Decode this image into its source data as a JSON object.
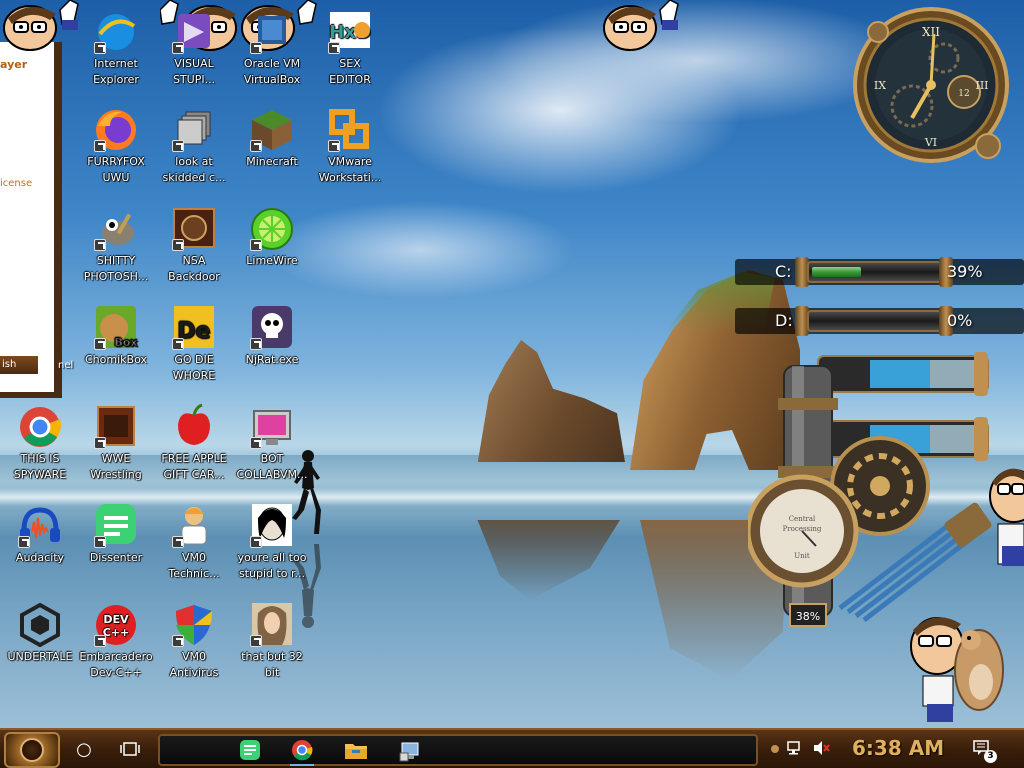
{
  "desktop": {
    "icons": [
      {
        "id": "ie",
        "label": "Internet\nExplorer"
      },
      {
        "id": "vs",
        "label": "VISUAL\nSTUPI..."
      },
      {
        "id": "vbox",
        "label": "Oracle VM\nVirtualBox"
      },
      {
        "id": "hxd",
        "label": "SEX\nEDITOR"
      },
      {
        "id": "firefox",
        "label": "FURRYFOX\nUWU"
      },
      {
        "id": "skidded",
        "label": "look at\nskidded c..."
      },
      {
        "id": "minecraft",
        "label": "Minecraft"
      },
      {
        "id": "vmware",
        "label": "VMware\nWorkstati..."
      },
      {
        "id": "gimp",
        "label": "SHITTY\nPHOTOSH..."
      },
      {
        "id": "nsa",
        "label": "NSA\nBackdoor"
      },
      {
        "id": "limewire",
        "label": "LimeWire"
      },
      {
        "id": "chomik",
        "label": "ChomikBox"
      },
      {
        "id": "godie",
        "label": "GO DIE\nWHORE"
      },
      {
        "id": "njrat",
        "label": "NjRat.exe"
      },
      {
        "id": "chrome",
        "label": "THIS IS\nSPYWARE"
      },
      {
        "id": "wwe",
        "label": "WWE\nWrestling"
      },
      {
        "id": "apple",
        "label": "FREE APPLE\nGIFT CAR..."
      },
      {
        "id": "bot",
        "label": "BOT\nCOLLABVM..."
      },
      {
        "id": "audacity",
        "label": "Audacity"
      },
      {
        "id": "dissenter",
        "label": "Dissenter"
      },
      {
        "id": "vm0tech",
        "label": "VM0\nTechnic..."
      },
      {
        "id": "stupid",
        "label": "youre all too\nstupid to r..."
      },
      {
        "id": "undertale",
        "label": "UNDERTALE"
      },
      {
        "id": "devcpp",
        "label": "Embarcadero\nDev-C++"
      },
      {
        "id": "vm0av",
        "label": "VM0\nAntivirus"
      },
      {
        "id": "32bit",
        "label": "that but 32\nbit"
      }
    ],
    "icon_badges": {
      "box": "Box",
      "de": "De",
      "dev": "DEV",
      "cpp": "C++",
      "hxd": "HxD"
    }
  },
  "app_window": {
    "title_fragment": "ayer",
    "text_fragment": "icense",
    "button_fragment": "ish",
    "side_fragment": "nel"
  },
  "clock_widget": {
    "numeral_top": "XII",
    "numeral_center": "12"
  },
  "disks": [
    {
      "label": "C:",
      "percent_text": "39%",
      "fill_fraction": 0.39
    },
    {
      "label": "D:",
      "percent_text": "0%",
      "fill_fraction": 0.0
    }
  ],
  "machine": {
    "gauge_label_top": "Central",
    "gauge_label_mid": "Processing",
    "gauge_label_bottom": "Unit",
    "cpu_readout": "38%"
  },
  "taskbar": {
    "time": "6:38 AM",
    "notification_count": "3",
    "pinned": [
      "dissenter",
      "chrome",
      "file-explorer",
      "control-panel"
    ]
  },
  "colors": {
    "accent": "#e0b060",
    "taskbar": "#3a1f0b",
    "disk_fill": "#3a9a3a"
  }
}
